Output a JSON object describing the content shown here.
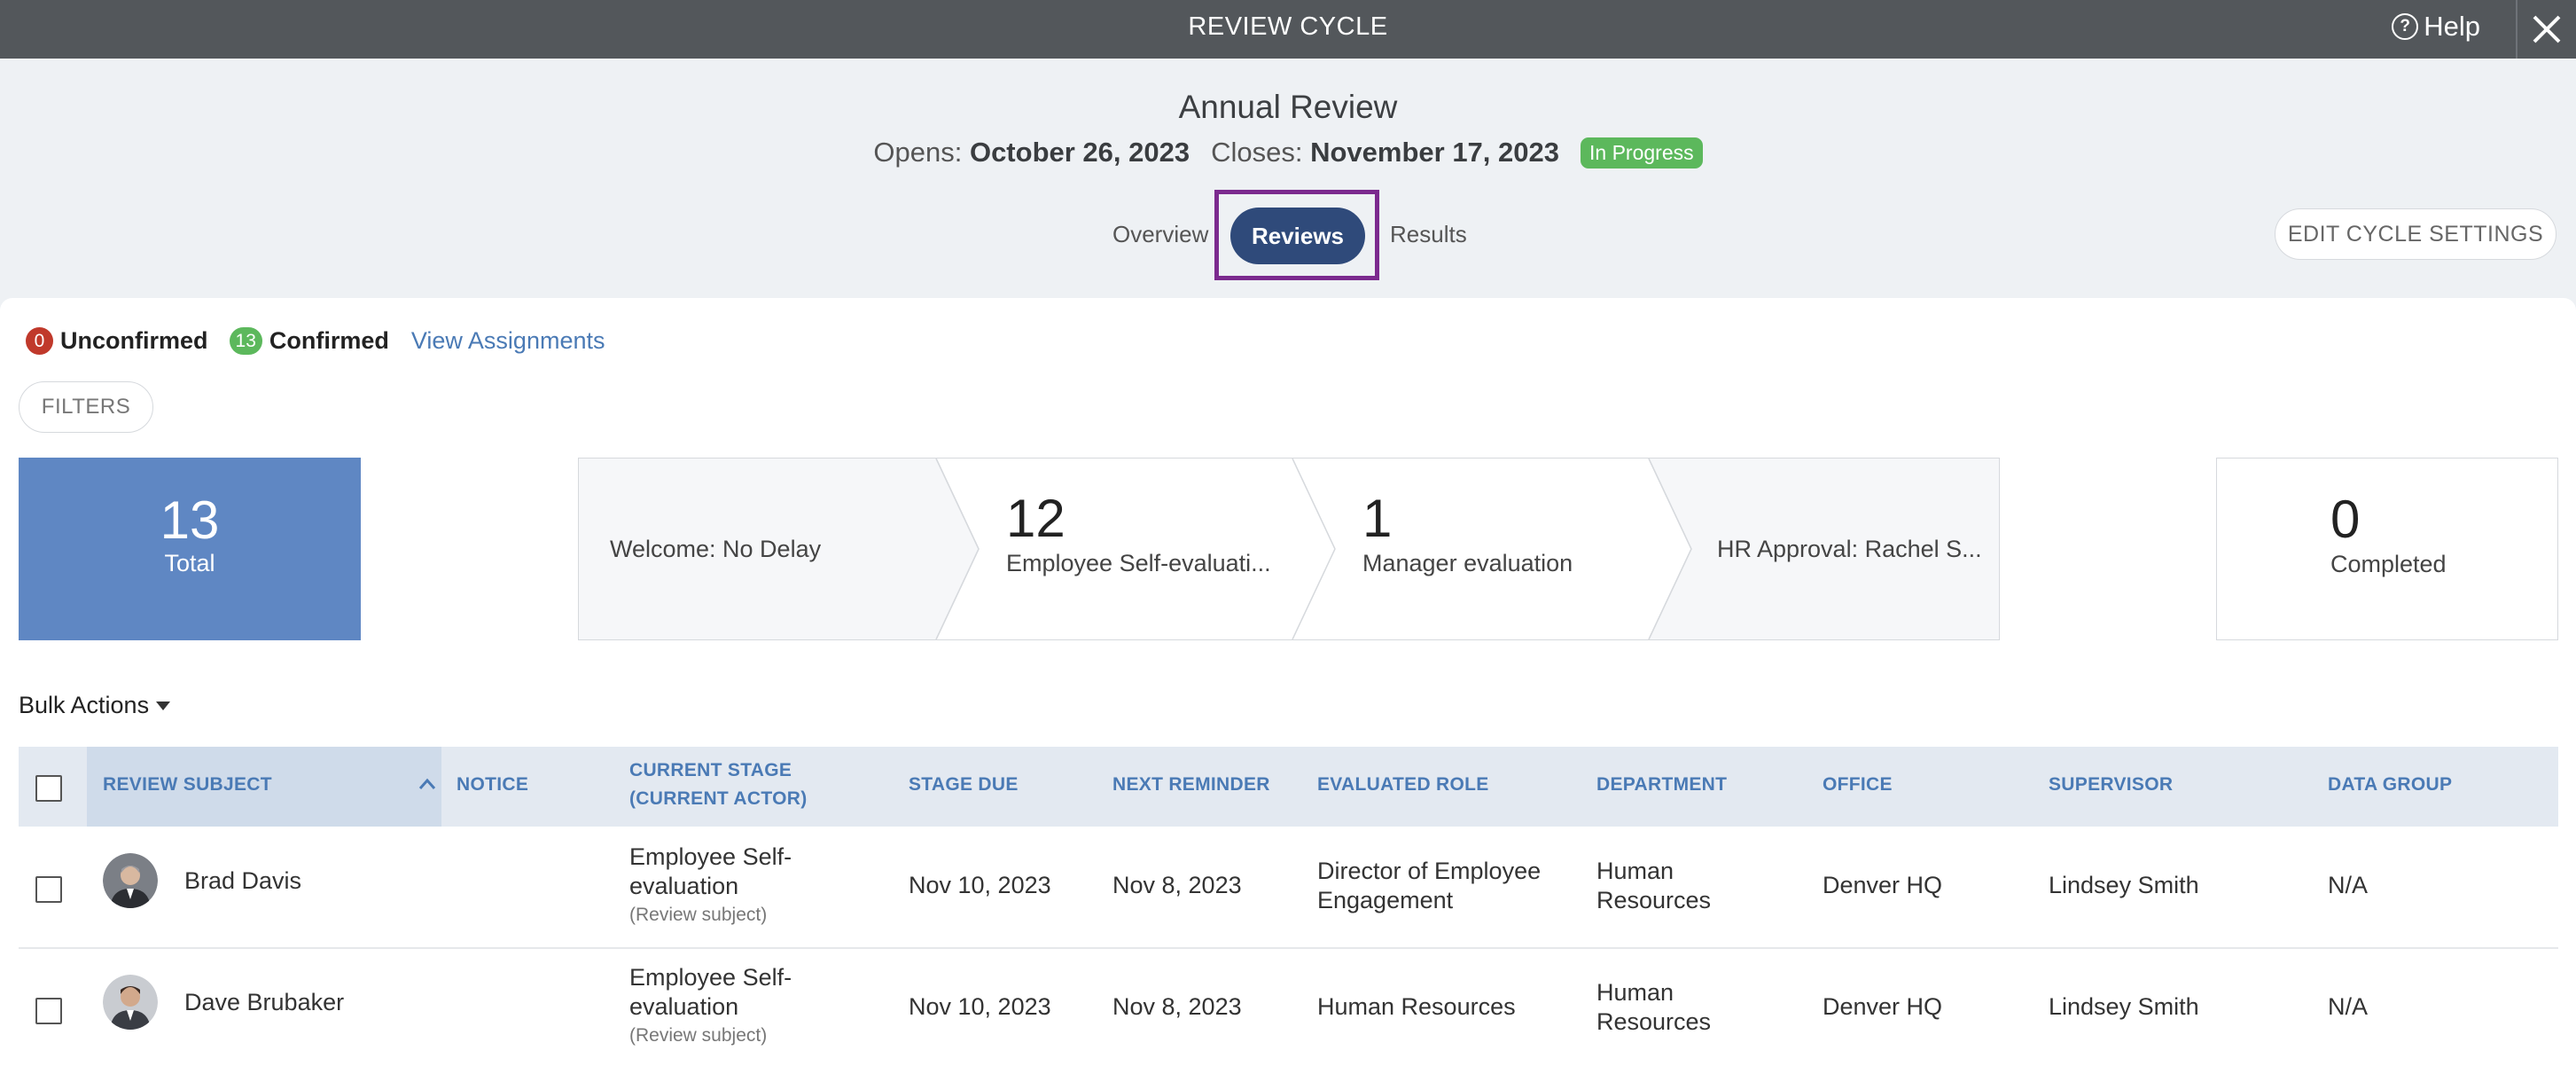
{
  "topbar": {
    "title": "REVIEW CYCLE",
    "help_label": "Help"
  },
  "cycle": {
    "name": "Annual Review",
    "opens_label": "Opens:",
    "opens_date": "October 26, 2023",
    "closes_label": "Closes:",
    "closes_date": "November 17, 2023",
    "status": "In Progress"
  },
  "tabs": [
    {
      "label": "Overview"
    },
    {
      "label": "Reviews",
      "selected": true
    },
    {
      "label": "Results"
    }
  ],
  "edit_settings_label": "EDIT CYCLE SETTINGS",
  "confirmation": {
    "unconfirmed_count": "0",
    "unconfirmed_label": "Unconfirmed",
    "confirmed_count": "13",
    "confirmed_label": "Confirmed",
    "view_assignments": "View Assignments"
  },
  "filters_label": "FILTERS",
  "summary": {
    "total": {
      "count": "13",
      "label": "Total"
    },
    "stages": [
      {
        "label": "Welcome: No Delay"
      },
      {
        "count": "12",
        "label": "Employee Self-evaluati..."
      },
      {
        "count": "1",
        "label": "Manager evaluation"
      },
      {
        "label": "HR Approval: Rachel S..."
      }
    ],
    "completed": {
      "count": "0",
      "label": "Completed"
    }
  },
  "bulk_actions_label": "Bulk Actions",
  "table": {
    "columns": [
      "REVIEW SUBJECT",
      "NOTICE",
      "CURRENT STAGE",
      "(CURRENT ACTOR)",
      "STAGE DUE",
      "NEXT REMINDER",
      "EVALUATED ROLE",
      "DEPARTMENT",
      "OFFICE",
      "SUPERVISOR",
      "DATA GROUP"
    ],
    "rows": [
      {
        "subject": "Brad Davis",
        "stage_line1": "Employee Self-",
        "stage_line2": "evaluation",
        "actor": "(Review subject)",
        "stage_due": "Nov 10, 2023",
        "next_reminder": "Nov 8, 2023",
        "role_line1": "Director of Employee",
        "role_line2": "Engagement",
        "dept_line1": "Human",
        "dept_line2": "Resources",
        "office": "Denver HQ",
        "supervisor": "Lindsey Smith",
        "data_group": "N/A"
      },
      {
        "subject": "Dave Brubaker",
        "stage_line1": "Employee Self-",
        "stage_line2": "evaluation",
        "actor": "(Review subject)",
        "stage_due": "Nov 10, 2023",
        "next_reminder": "Nov 8, 2023",
        "role_line1": "Human Resources",
        "role_line2": "",
        "dept_line1": "Human",
        "dept_line2": "Resources",
        "office": "Denver HQ",
        "supervisor": "Lindsey Smith",
        "data_group": "N/A"
      }
    ]
  },
  "colors": {
    "topbar": "#53575b",
    "accent_blue": "#4a7ab5",
    "selected_tab": "#2f4a7a",
    "highlight_border": "#7b2a8e",
    "unconfirmed": "#c0392b",
    "confirmed": "#5cb85c",
    "total_box": "#5f87c3"
  }
}
